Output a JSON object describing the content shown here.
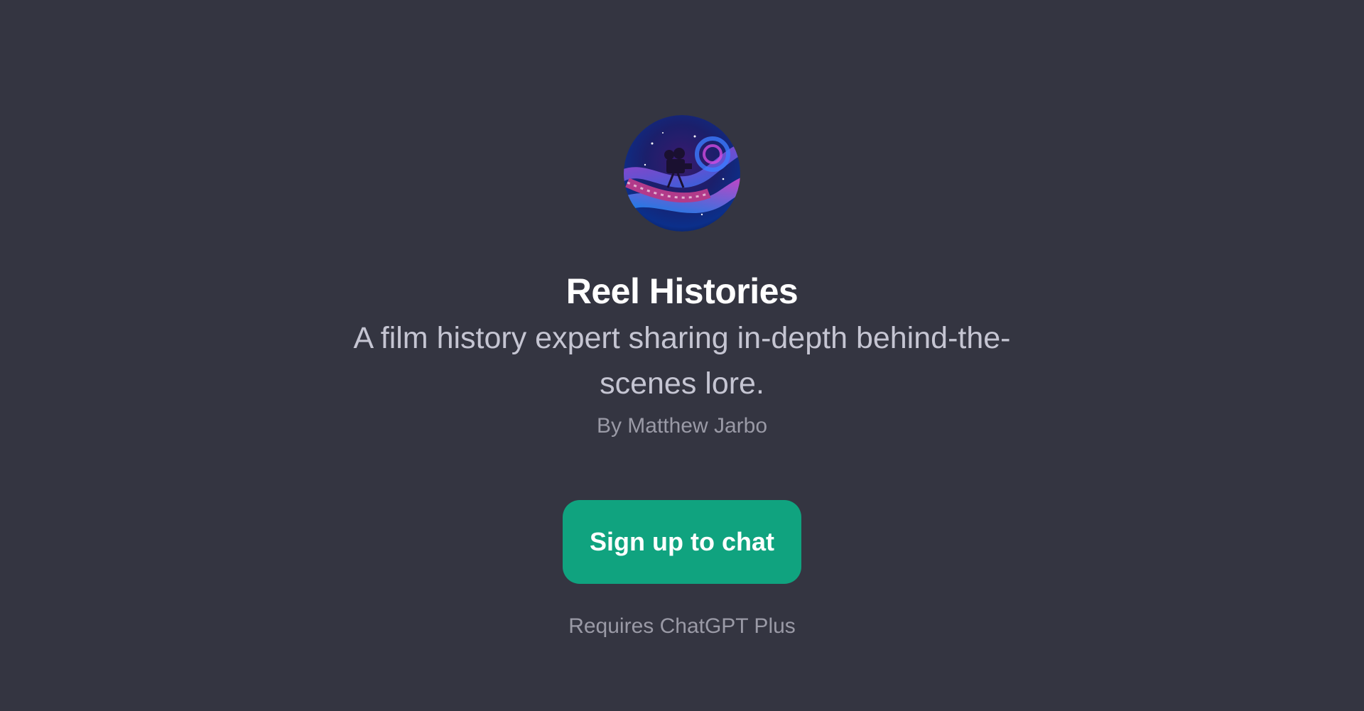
{
  "gpt": {
    "avatar_icon": "film-projector-cosmic-avatar",
    "title": "Reel Histories",
    "description": "A film history expert sharing in-depth behind-the-scenes lore.",
    "author": "By Matthew Jarbo"
  },
  "cta": {
    "signup_label": "Sign up to chat",
    "requirement": "Requires ChatGPT Plus"
  },
  "colors": {
    "background": "#343541",
    "button": "#10a37f",
    "title": "#ffffff",
    "description": "#c5c5d2",
    "muted": "#9a9aa6"
  }
}
